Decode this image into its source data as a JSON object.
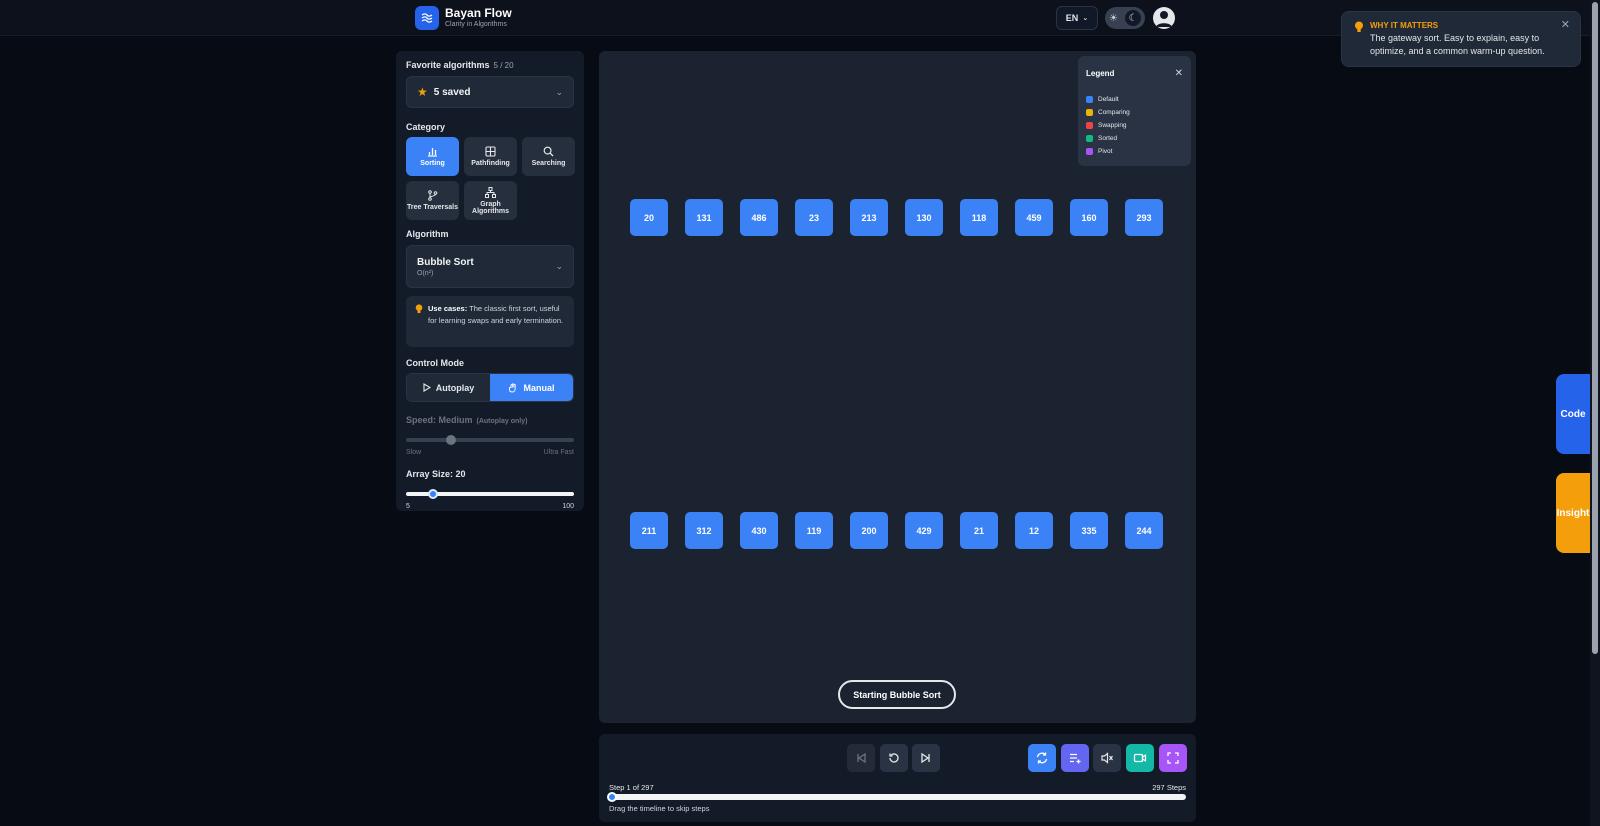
{
  "header": {
    "app_title": "Bayan Flow",
    "app_subtitle": "Clarity in Algorithms",
    "language": "EN"
  },
  "toast": {
    "title": "WHY IT MATTERS",
    "body": "The gateway sort. Easy to explain, easy to optimize, and a common warm-up question."
  },
  "sidebar": {
    "favorites_label": "Favorite algorithms",
    "favorites_count": "5 / 20",
    "favorites_value": "5 saved",
    "category_label": "Category",
    "categories": [
      {
        "label": "Sorting",
        "icon": "bar-chart-icon",
        "active": true
      },
      {
        "label": "Pathfinding",
        "icon": "grid-icon",
        "active": false
      },
      {
        "label": "Searching",
        "icon": "search-icon",
        "active": false
      },
      {
        "label": "Tree Traversals",
        "icon": "git-branch-icon",
        "active": false
      },
      {
        "label": "Graph Algorithms",
        "icon": "network-icon",
        "active": false
      }
    ],
    "algorithm_label": "Algorithm",
    "algorithm_name": "Bubble Sort",
    "algorithm_complexity": "O(n²)",
    "usecase_title": "Use cases:",
    "usecase_text": "The classic first sort, useful for learning swaps and early termination.",
    "control_mode_label": "Control Mode",
    "mode_autoplay": "Autoplay",
    "mode_manual": "Manual",
    "active_mode": "Manual",
    "speed_label": "Speed: Medium",
    "speed_note": "(Autoplay only)",
    "speed_min": "Slow",
    "speed_max": "Ultra Fast",
    "speed_fraction": 0.27,
    "array_size_label": "Array Size: 20",
    "array_min": "5",
    "array_max": "100",
    "array_value": 20
  },
  "legend": {
    "title": "Legend",
    "items": [
      {
        "label": "Default",
        "color": "#3b82f6"
      },
      {
        "label": "Comparing",
        "color": "#eab308"
      },
      {
        "label": "Swapping",
        "color": "#ef4444"
      },
      {
        "label": "Sorted",
        "color": "#10b981"
      },
      {
        "label": "Pivot",
        "color": "#a855f7"
      }
    ]
  },
  "array_values": [
    20,
    131,
    486,
    23,
    213,
    130,
    118,
    459,
    160,
    293,
    211,
    312,
    430,
    119,
    200,
    429,
    21,
    12,
    335,
    244
  ],
  "status_text": "Starting Bubble Sort",
  "player": {
    "step_text": "Step 1 of 297",
    "total_steps": "297 Steps",
    "current_step": 1,
    "step_count": 297,
    "drag_hint": "Drag the timeline to skip steps",
    "buttons": [
      {
        "name": "first-step-button",
        "icon": "skip-back-icon",
        "color": "#232b38"
      },
      {
        "name": "reset-button",
        "icon": "rotate-ccw-icon",
        "color": "#2a3343"
      },
      {
        "name": "next-step-button",
        "icon": "skip-forward-icon",
        "color": "#2a3343"
      },
      {
        "name": "shuffle-button",
        "icon": "refresh-icon",
        "color": "#3b82f6"
      },
      {
        "name": "custom-input-button",
        "icon": "list-plus-icon",
        "color": "#6366f1"
      },
      {
        "name": "mute-button",
        "icon": "volume-off-icon",
        "color": "#2a3343"
      },
      {
        "name": "record-button",
        "icon": "video-icon",
        "color": "#14b8a6"
      },
      {
        "name": "fullscreen-button",
        "icon": "maximize-icon",
        "color": "#a855f7"
      }
    ]
  },
  "side_tabs": {
    "code": "Code",
    "insight": "Insight"
  }
}
